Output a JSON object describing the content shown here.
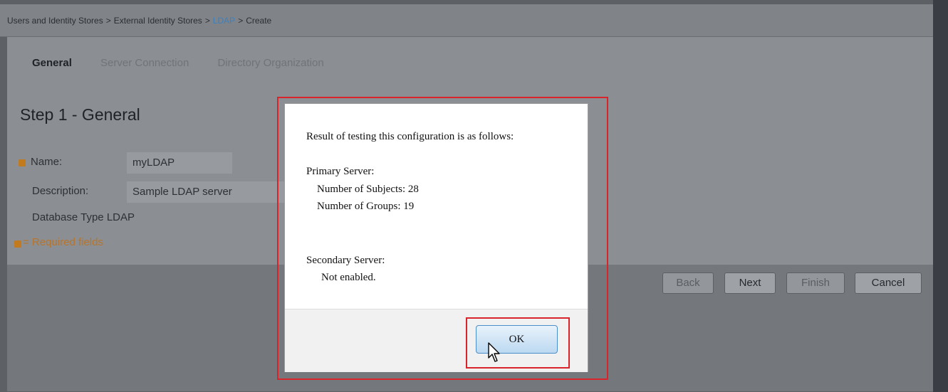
{
  "breadcrumb": {
    "item1": "Users and Identity Stores",
    "item2": "External Identity Stores",
    "item3": "LDAP",
    "item4": "Create",
    "separator": ">"
  },
  "tabs": [
    "General",
    "Server Connection",
    "Directory Organization"
  ],
  "step_title": "Step 1 - General",
  "form": {
    "name_label": "Name:",
    "name_value": "myLDAP",
    "description_label": "Description:",
    "description_value": "Sample LDAP server",
    "db_type_label": "Database Type",
    "db_type_value": "LDAP",
    "required_note": "= Required fields"
  },
  "wizard_buttons": {
    "back": "Back",
    "next": "Next",
    "finish": "Finish",
    "cancel": "Cancel"
  },
  "dialog": {
    "intro": "Result of testing this configuration is as follows:",
    "primary_heading": "Primary Server:",
    "subjects": "Number of Subjects: 28",
    "groups": "Number of Groups: 19",
    "secondary_heading": "Secondary Server:",
    "secondary_status": "Not enabled.",
    "ok_label": "OK"
  },
  "colors": {
    "highlight": "#d9242b",
    "required": "#c17a1e",
    "link": "#3f7fb8"
  }
}
